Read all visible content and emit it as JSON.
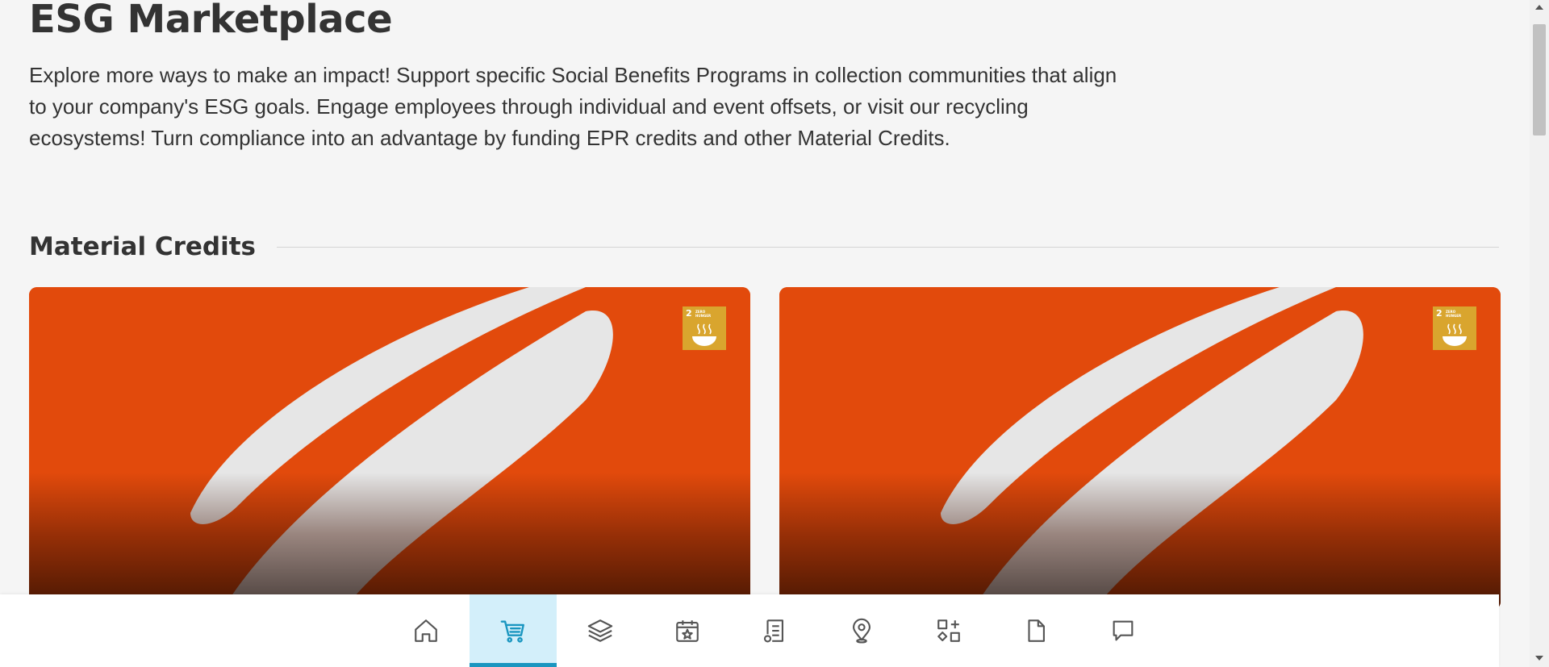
{
  "page": {
    "title": "ESG Marketplace",
    "intro": "Explore more ways to make an impact! Support specific Social Benefits Programs in collection communities that align to your company's ESG goals. Engage employees through individual and event offsets, or visit our recycling ecosystems! Turn compliance into an advantage by funding EPR credits and other Material Credits."
  },
  "section": {
    "title": "Material Credits"
  },
  "cards": [
    {
      "sdg_number": "2",
      "sdg_text": "ZERO HUNGER",
      "badge_color": "#d9a52e",
      "background_color": "#e24a0c"
    },
    {
      "sdg_number": "2",
      "sdg_text": "ZERO HUNGER",
      "badge_color": "#d9a52e",
      "background_color": "#e24a0c"
    }
  ],
  "nav": {
    "active_index": 1,
    "accent": "#1a96c0",
    "items": [
      {
        "icon": "home-icon"
      },
      {
        "icon": "cart-icon"
      },
      {
        "icon": "layers-icon"
      },
      {
        "icon": "calendar-star-icon"
      },
      {
        "icon": "document-list-icon"
      },
      {
        "icon": "map-pin-icon"
      },
      {
        "icon": "apps-icon"
      },
      {
        "icon": "file-icon"
      },
      {
        "icon": "chat-icon"
      }
    ]
  }
}
